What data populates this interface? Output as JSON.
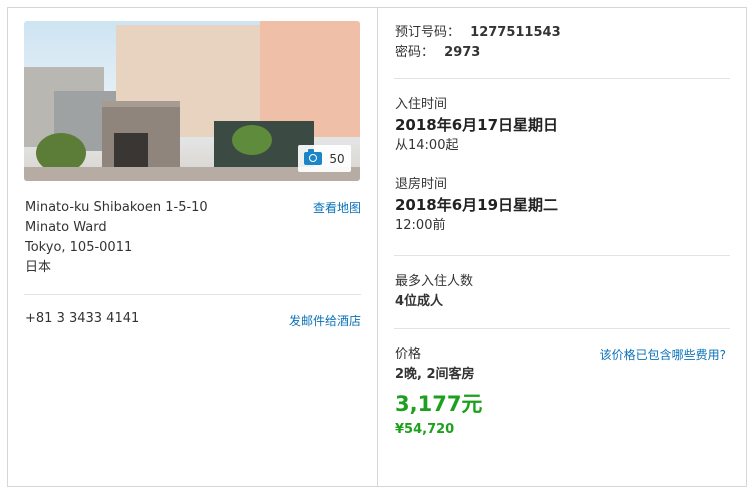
{
  "hotel": {
    "photo_count": "50",
    "address_lines": [
      "Minato-ku Shibakoen 1-5-10",
      "Minato Ward",
      "Tokyo, 105-0011",
      "日本"
    ],
    "map_link": "查看地图",
    "phone": "+81 3 3433 4141",
    "mail_link": "发邮件给酒店"
  },
  "booking": {
    "confirmation_label": "预订号码：",
    "confirmation_value": "1277511543",
    "pin_label": "密码：",
    "pin_value": "2973"
  },
  "checkin": {
    "label": "入住时间",
    "date": "2018年6月17日星期日",
    "time": "从14:00起"
  },
  "checkout": {
    "label": "退房时间",
    "date": "2018年6月19日星期二",
    "time": "12:00前"
  },
  "guests": {
    "label": "最多入住人数",
    "value": "4位成人"
  },
  "price": {
    "label": "价格",
    "fee_link": "该价格已包含哪些费用?",
    "summary": "2晚, 2间客房",
    "total_cny": "3,177元",
    "total_jpy": "¥54,720"
  }
}
